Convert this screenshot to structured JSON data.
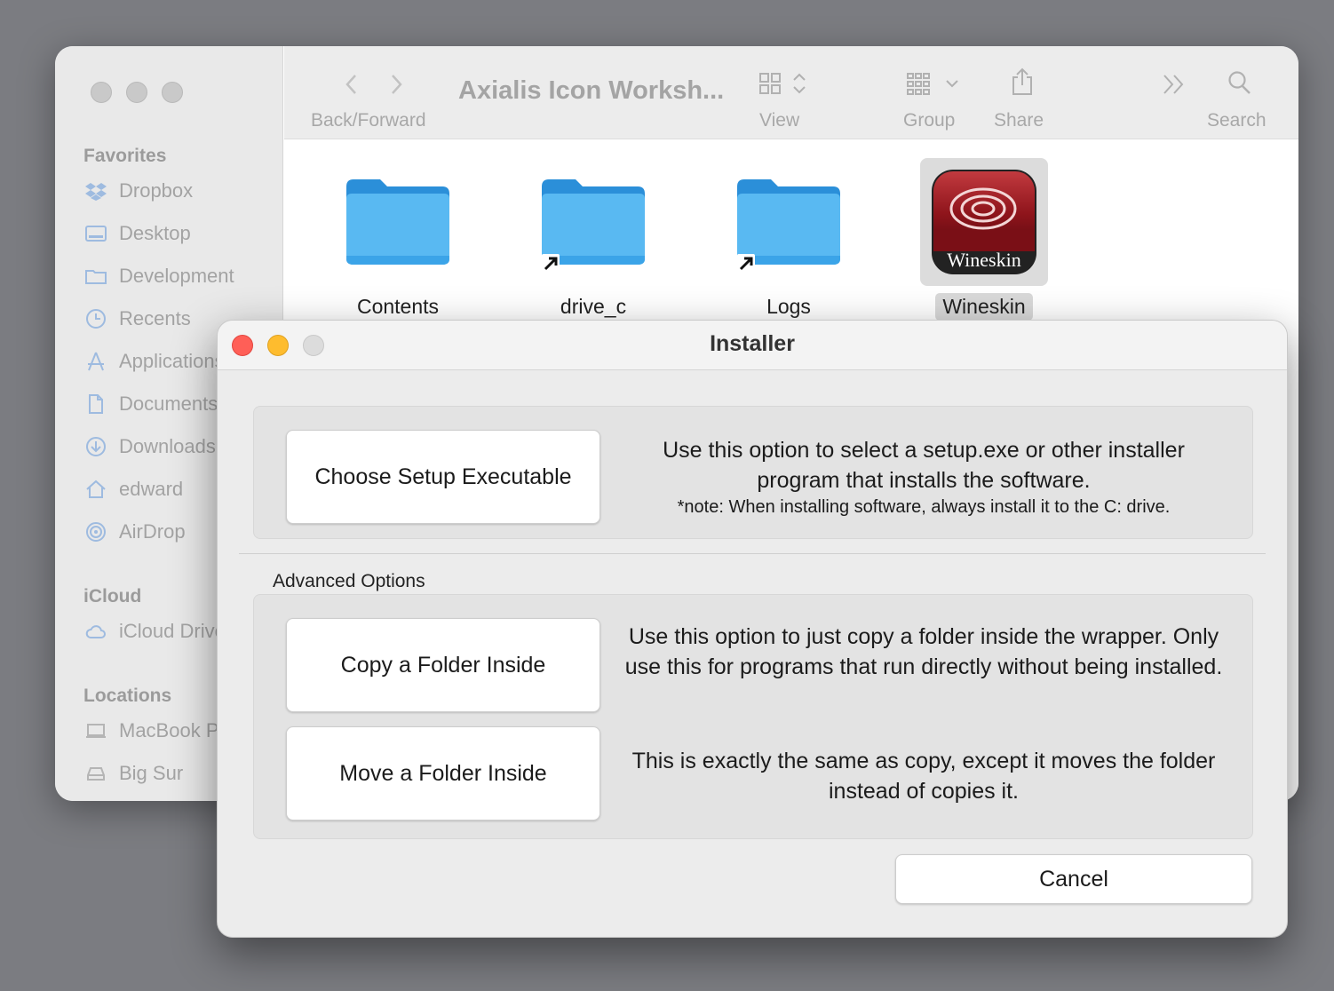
{
  "finder": {
    "title": "Axialis Icon Worksh...",
    "toolbar": {
      "back_forward_label": "Back/Forward",
      "view_label": "View",
      "group_label": "Group",
      "share_label": "Share",
      "search_label": "Search"
    },
    "sidebar": {
      "favorites_header": "Favorites",
      "favorites": [
        {
          "label": "Dropbox",
          "icon": "dropbox-icon"
        },
        {
          "label": "Desktop",
          "icon": "desktop-icon"
        },
        {
          "label": "Development",
          "icon": "folder-icon"
        },
        {
          "label": "Recents",
          "icon": "clock-icon"
        },
        {
          "label": "Applications",
          "icon": "applications-icon"
        },
        {
          "label": "Documents",
          "icon": "document-icon"
        },
        {
          "label": "Downloads",
          "icon": "download-icon"
        },
        {
          "label": "edward",
          "icon": "home-icon"
        },
        {
          "label": "AirDrop",
          "icon": "airdrop-icon"
        }
      ],
      "icloud_header": "iCloud",
      "icloud": [
        {
          "label": "iCloud Drive",
          "icon": "cloud-icon"
        }
      ],
      "locations_header": "Locations",
      "locations": [
        {
          "label": "MacBook Pro",
          "icon": "laptop-icon"
        },
        {
          "label": "Big Sur",
          "icon": "disk-icon"
        }
      ]
    },
    "files": [
      {
        "label": "Contents",
        "icon": "folder-icon",
        "alias": false
      },
      {
        "label": "drive_c",
        "icon": "folder-icon",
        "alias": true
      },
      {
        "label": "Logs",
        "icon": "folder-icon",
        "alias": true
      },
      {
        "label": "Wineskin",
        "icon": "wineskin-app-icon",
        "selected": true
      }
    ],
    "wineskin_icon_text": "Wineskin"
  },
  "dialog": {
    "title": "Installer",
    "setup": {
      "button_label": "Choose Setup Executable",
      "description": "Use this option to select a setup.exe or other installer program that installs the software.",
      "note": "*note: When installing software, always install it to the C: drive."
    },
    "advanced_label": "Advanced Options",
    "copy": {
      "button_label": "Copy a Folder Inside",
      "description": "Use this option to just copy a folder inside the wrapper. Only use this for programs that run directly without being installed."
    },
    "move": {
      "button_label": "Move a Folder Inside",
      "description": "This is exactly the same as copy, except it moves the folder instead of copies it."
    },
    "cancel_label": "Cancel"
  }
}
